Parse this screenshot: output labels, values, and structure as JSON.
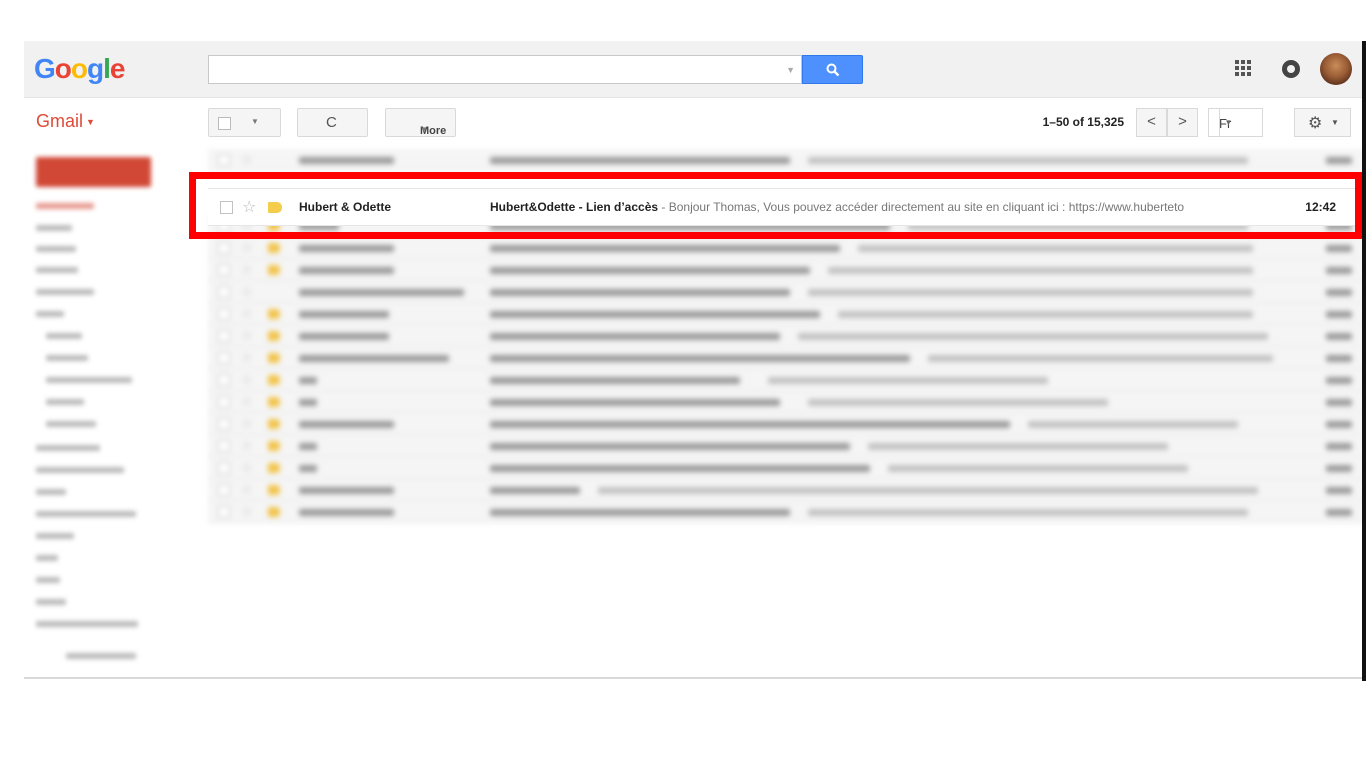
{
  "header": {
    "logo": "Google",
    "search": {
      "value": "",
      "placeholder": ""
    }
  },
  "toolbar": {
    "gmail_label": "Gmail",
    "refresh_glyph": "C",
    "more_label": "More",
    "pager": "1–50 of 15,325",
    "prev_glyph": "<",
    "next_glyph": ">",
    "input_language": "Fr"
  },
  "focused_email": {
    "sender": "Hubert & Odette",
    "subject": "Hubert&Odette - Lien d’accès",
    "snippet": " - Bonjour Thomas, Vous pouvez accéder directement au site en cliquant ici : https://www.huberteto",
    "time": "12:42",
    "starred": false
  },
  "icons": {
    "search": "search-icon",
    "apps": "apps-grid-icon",
    "notifications": "notifications-icon",
    "settings": "gear-icon"
  },
  "colors": {
    "gmail_red": "#dd4b39",
    "search_blue": "#4d90fe",
    "highlight": "#ff0000",
    "label_yellow": "#f5cd4c"
  }
}
